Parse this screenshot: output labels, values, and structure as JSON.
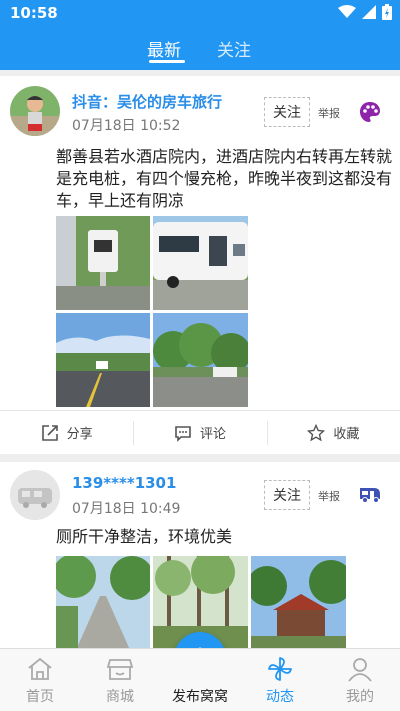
{
  "status": {
    "time": "10:58"
  },
  "tabs": [
    {
      "label": "最新"
    },
    {
      "label": "关注"
    }
  ],
  "posts": [
    {
      "username": "抖音：吴伦的房车旅行",
      "time": "07月18日 10:52",
      "follow_label": "关注",
      "report_label": "举报",
      "badge_icon": "palette-icon",
      "text": "鄯善县若水酒店院内，进酒店院内右转再左转就是充电桩，有四个慢充枪，昨晚半夜到这都没有车，早上还有阴凉",
      "photos": [
        "charging-station",
        "rv-camper",
        "parking-lot",
        "courtyard-trees"
      ]
    },
    {
      "username": "139****1301",
      "time": "07月18日 10:49",
      "follow_label": "关注",
      "report_label": "举报",
      "badge_icon": "rv-icon",
      "text": "厕所干净整洁，环境优美",
      "photos": [
        "tree-lined-road",
        "forest",
        "red-roof-house"
      ]
    }
  ],
  "actions": {
    "share": "分享",
    "comment": "评论",
    "favorite": "收藏"
  },
  "nav": {
    "items": [
      {
        "label": "首页",
        "icon": "home-icon"
      },
      {
        "label": "商城",
        "icon": "shop-icon"
      },
      {
        "label": "动态",
        "icon": "pinwheel-icon"
      },
      {
        "label": "我的",
        "icon": "profile-icon"
      }
    ],
    "publish_label": "发布窝窝",
    "active": "动态"
  },
  "colors": {
    "primary": "#2196f3",
    "username": "#2a8ee8",
    "badge_purple": "#8e24aa",
    "badge_blue": "#3f51b5"
  }
}
